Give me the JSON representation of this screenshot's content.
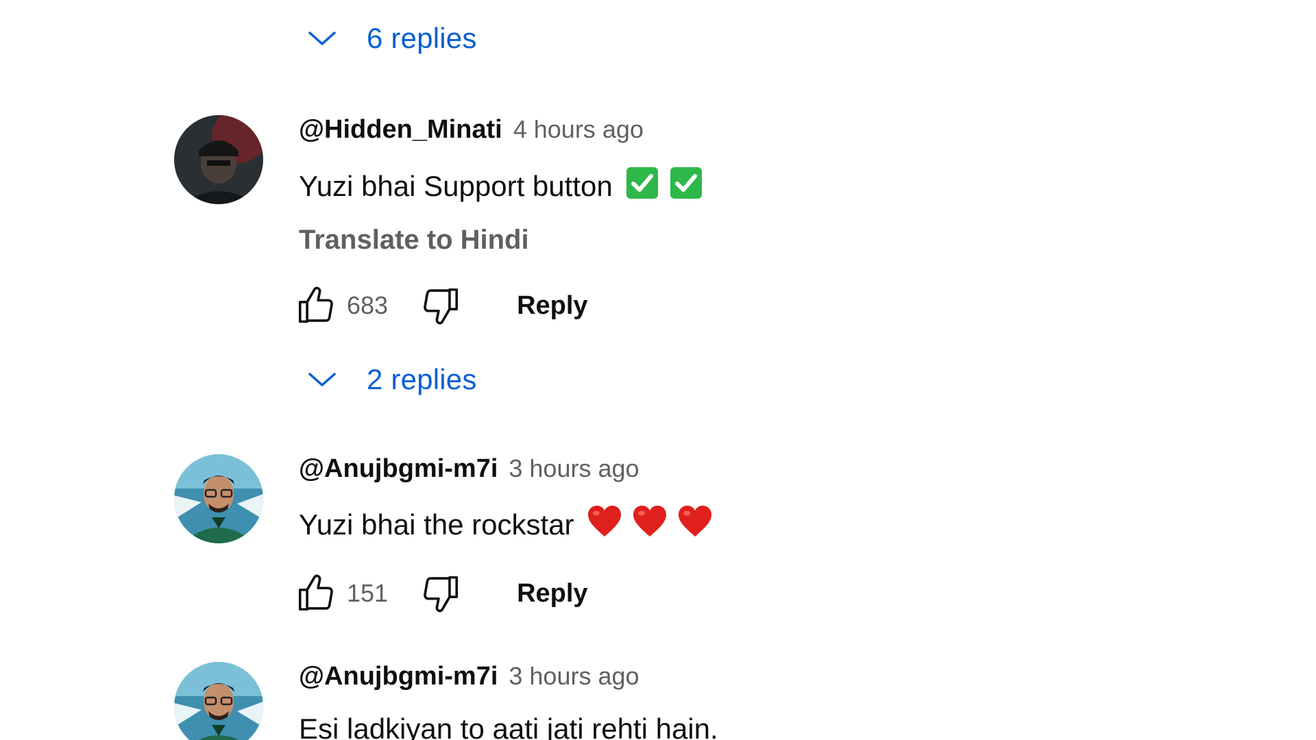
{
  "top_replies": {
    "label": "6 replies"
  },
  "comments": [
    {
      "author": "@Hidden_Minati",
      "time": "4 hours ago",
      "text": "Yuzi bhai Support button",
      "emoji": [
        "✅",
        "✅"
      ],
      "translate": "Translate to Hindi",
      "likes": "683",
      "reply_label": "Reply",
      "replies_label": "2 replies"
    },
    {
      "author": "@Anujbgmi-m7i",
      "time": "3 hours ago",
      "text": "Yuzi bhai the rockstar",
      "emoji": [
        "❤",
        "❤",
        "❤"
      ],
      "likes": "151",
      "reply_label": "Reply"
    },
    {
      "author": "@Anujbgmi-m7i",
      "time": "3 hours ago",
      "text": "Esi ladkiyan to aati jati rehti hain."
    }
  ],
  "colors": {
    "link_blue": "#065fd4",
    "secondary_text": "#606060",
    "check_green": "#2eb84a",
    "heart_red": "#e0201c"
  }
}
